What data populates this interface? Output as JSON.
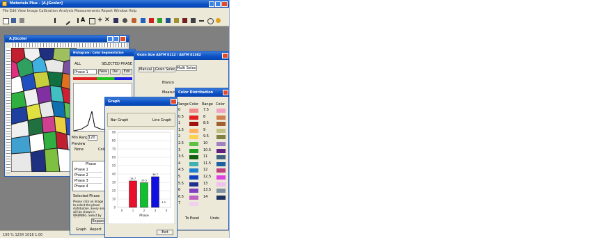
{
  "app": {
    "title": "Materials Plus - [A.JGcolor]"
  },
  "menubar": {
    "text": "File  Edit  View  Image  Calibration  Analysis  Measurements  Report  Window  Help"
  },
  "child_window": {
    "title": "A.JGcolor"
  },
  "status_bar": {
    "text": "100 %  1234 1018  1.00"
  },
  "seg_dialog": {
    "title": "Histogram / Color Segmentation",
    "radio_all": "ALL",
    "radio_selected": "SELECTED PHASE",
    "phase_select": "Phase 1",
    "btn_new": "New",
    "btn_del": "Del",
    "btn_edit": "Edit",
    "range_label": "Min Range",
    "range_value": "120",
    "preview_label": "Preview",
    "preview_opt1": "None",
    "preview_opt2": "Color",
    "table_header": "Phase",
    "table_rows": [
      "Phase 1",
      "Phase 2",
      "Phase 3",
      "Phase 4"
    ],
    "selected_phase_label": "Selected Phase",
    "help_text": "Please click on Image to select the phase distribution. Every area will be shown in WARNING. Select by click.",
    "btn_expand": "Expand",
    "btn_graph": "Graph",
    "btn_report": "Report"
  },
  "grain_dialog": {
    "title": "Grain Size ASTM E112 / ASTM E1382",
    "tabs": [
      "Manual",
      "Grain Selection",
      "Multi Select"
    ],
    "item1": "Blanco",
    "item2": "Measure"
  },
  "color_dialog": {
    "title": "Color Distribution",
    "headers": [
      "Range",
      "Color",
      "Range",
      "Color"
    ],
    "col1_ranges": [
      "0",
      "0.5",
      "1",
      "1.5",
      "2",
      "2.5",
      "3",
      "3.5",
      "4",
      "4.5",
      "5",
      "5.5",
      "6",
      "6.5",
      "7"
    ],
    "col2_ranges": [
      "7.5",
      "8",
      "8.5",
      "9",
      "9.5",
      "10",
      "10.5",
      "11",
      "11.5",
      "12",
      "12.5",
      "13",
      "13.5",
      "14"
    ],
    "col1_colors": [
      "#f08a8a",
      "#e02020",
      "#a01010",
      "#ffb060",
      "#ffd050",
      "#60c040",
      "#20a020",
      "#106010",
      "#40b0b0",
      "#2080d0",
      "#1040c0",
      "#203090",
      "#8040c0",
      "#c060c0",
      "#f0d0f0"
    ],
    "col2_colors": [
      "#f0a0c0",
      "#d08050",
      "#a06030",
      "#c0c080",
      "#808040",
      "#a080c0",
      "#602080",
      "#406080",
      "#2060a0",
      "#c04080",
      "#e040e0",
      "#f0c0f0",
      "#8090a0",
      "#203060"
    ],
    "btn_to_excel": "To Excel",
    "btn_undo": "Undo"
  },
  "graph_dialog": {
    "title": "Graph",
    "radio_bar": "Bar Graph",
    "radio_line": "Line Graph",
    "btn_exit": "Exit"
  },
  "chart_data": {
    "type": "bar",
    "categories": [
      "1",
      "2",
      "3"
    ],
    "values": [
      31.7,
      29.5,
      36.7
    ],
    "bar_labels": [
      "33.7",
      "29.5",
      "38.7"
    ],
    "extra_label": "3.5",
    "colors": [
      "#e8102a",
      "#10c030",
      "#1010e0"
    ],
    "yticks": [
      "0",
      "10",
      "20",
      "30",
      "40",
      "50",
      "60",
      "70",
      "80",
      "90"
    ],
    "xticks": [
      "0",
      "1",
      "2",
      "3",
      "4"
    ],
    "xlabel": "Phase",
    "ylim": [
      0,
      90
    ]
  }
}
